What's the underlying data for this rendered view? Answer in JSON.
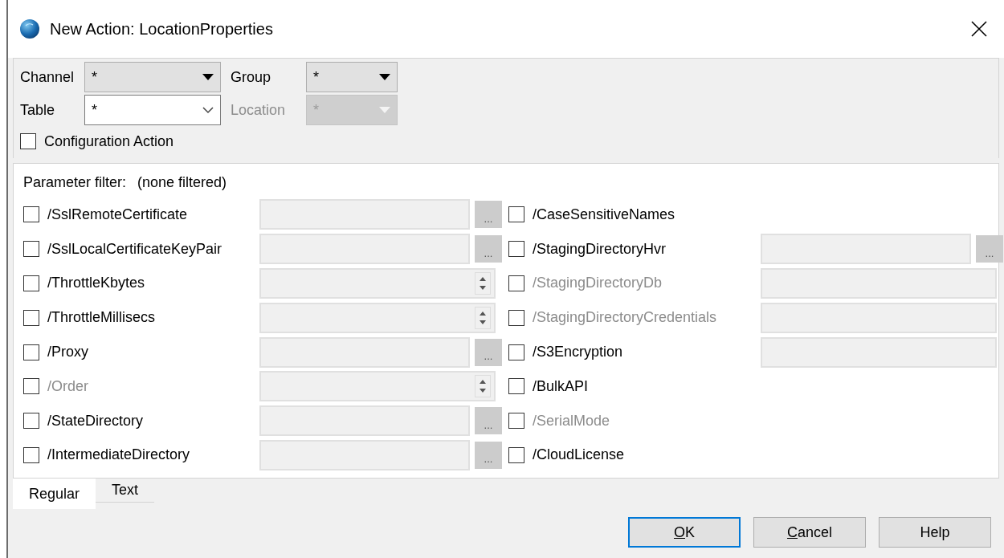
{
  "window": {
    "title": "New Action: LocationProperties"
  },
  "scope": {
    "fields": [
      {
        "label": "Channel",
        "value": "*",
        "kind": "dropdown",
        "disabled": false
      },
      {
        "label": "Group",
        "value": "*",
        "kind": "dropdown",
        "disabled": false
      },
      {
        "label": "Table",
        "value": "*",
        "kind": "editable",
        "disabled": false
      },
      {
        "label": "Location",
        "value": "*",
        "kind": "dropdown",
        "disabled": true
      }
    ],
    "configuration_action": {
      "label": "Configuration Action",
      "checked": false
    }
  },
  "parameter_filter": {
    "label": "Parameter filter:",
    "value": "(none filtered)"
  },
  "parameters_left": [
    {
      "label": "/SslRemoteCertificate",
      "checked": false,
      "disabled": false,
      "kind": "browse",
      "button": "..."
    },
    {
      "label": "/SslLocalCertificateKeyPair",
      "checked": false,
      "disabled": false,
      "kind": "browse",
      "button": "..."
    },
    {
      "label": "/ThrottleKbytes",
      "checked": false,
      "disabled": false,
      "kind": "spin"
    },
    {
      "label": "/ThrottleMillisecs",
      "checked": false,
      "disabled": false,
      "kind": "spin"
    },
    {
      "label": "/Proxy",
      "checked": false,
      "disabled": false,
      "kind": "browse",
      "button": "..."
    },
    {
      "label": "/Order",
      "checked": false,
      "disabled": true,
      "kind": "spin"
    },
    {
      "label": "/StateDirectory",
      "checked": false,
      "disabled": false,
      "kind": "browse",
      "button": "..."
    },
    {
      "label": "/IntermediateDirectory",
      "checked": false,
      "disabled": false,
      "kind": "browse",
      "button": "..."
    }
  ],
  "parameters_right": [
    {
      "label": "/CaseSensitiveNames",
      "checked": false,
      "disabled": false,
      "kind": "flag"
    },
    {
      "label": "/StagingDirectoryHvr",
      "checked": false,
      "disabled": false,
      "kind": "browse",
      "button": "..."
    },
    {
      "label": "/StagingDirectoryDb",
      "checked": false,
      "disabled": true,
      "kind": "text"
    },
    {
      "label": "/StagingDirectoryCredentials",
      "checked": false,
      "disabled": true,
      "kind": "text"
    },
    {
      "label": "/S3Encryption",
      "checked": false,
      "disabled": false,
      "kind": "text"
    },
    {
      "label": "/BulkAPI",
      "checked": false,
      "disabled": false,
      "kind": "flag"
    },
    {
      "label": "/SerialMode",
      "checked": false,
      "disabled": true,
      "kind": "flag"
    },
    {
      "label": "/CloudLicense",
      "checked": false,
      "disabled": false,
      "kind": "flag"
    }
  ],
  "tabs": [
    {
      "label": "Regular",
      "selected": true
    },
    {
      "label": "Text",
      "selected": false
    }
  ],
  "buttons": [
    {
      "label": "OK",
      "default": true,
      "mnemonic": true
    },
    {
      "label": "Cancel",
      "default": false,
      "mnemonic": true
    },
    {
      "label": "Help",
      "default": false,
      "mnemonic": false
    }
  ]
}
